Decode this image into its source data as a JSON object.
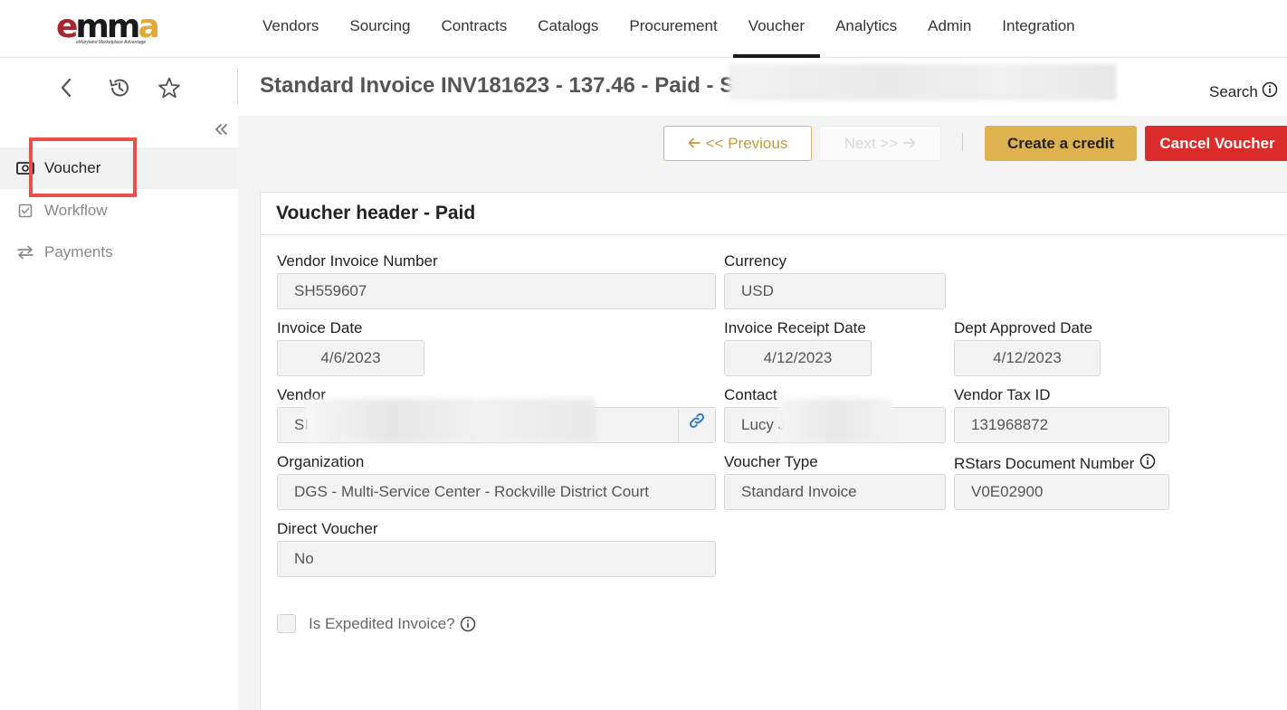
{
  "logo": {
    "text_e": "e",
    "text_mm": "mm",
    "text_a": "a",
    "tagline": "eMaryland Marketplace Advantage"
  },
  "nav": {
    "items": [
      {
        "label": "Vendors"
      },
      {
        "label": "Sourcing"
      },
      {
        "label": "Contracts"
      },
      {
        "label": "Catalogs"
      },
      {
        "label": "Procurement"
      },
      {
        "label": "Voucher"
      },
      {
        "label": "Analytics"
      },
      {
        "label": "Admin"
      },
      {
        "label": "Integration"
      }
    ],
    "active": "Voucher"
  },
  "subheader": {
    "title": "Standard Invoice INV181623 - 137.46 - Paid - SI",
    "search_label": "Search"
  },
  "sidebar": {
    "items": [
      {
        "label": "Voucher",
        "icon": "money-icon"
      },
      {
        "label": "Workflow",
        "icon": "checkbox-icon"
      },
      {
        "label": "Payments",
        "icon": "transfer-arrows-icon"
      }
    ],
    "active": "Voucher"
  },
  "actions": {
    "previous": "<< Previous",
    "next": "Next >>",
    "create_credit": "Create a credit",
    "cancel_voucher": "Cancel Voucher"
  },
  "card": {
    "title": "Voucher header - Paid",
    "fields": {
      "vendor_invoice_number": {
        "label": "Vendor Invoice Number",
        "value": "SH559607"
      },
      "currency": {
        "label": "Currency",
        "value": "USD"
      },
      "invoice_date": {
        "label": "Invoice Date",
        "value": "4/6/2023"
      },
      "invoice_receipt_date": {
        "label": "Invoice Receipt Date",
        "value": "4/12/2023"
      },
      "dept_approved_date": {
        "label": "Dept Approved Date",
        "value": "4/12/2023"
      },
      "vendor": {
        "label": "Vendor",
        "value": "SI"
      },
      "contact": {
        "label": "Contact",
        "value": "Lucy J"
      },
      "vendor_tax_id": {
        "label": "Vendor Tax ID",
        "value": "131968872"
      },
      "organization": {
        "label": "Organization",
        "value": "DGS - Multi-Service Center - Rockville District Court"
      },
      "voucher_type": {
        "label": "Voucher Type",
        "value": "Standard Invoice"
      },
      "rstars_document_number": {
        "label": "RStars Document Number",
        "value": "V0E02900"
      },
      "direct_voucher": {
        "label": "Direct Voucher",
        "value": "No"
      }
    },
    "expedited_label": "Is Expedited Invoice?"
  },
  "colors": {
    "accent_gold": "#ddb24f",
    "danger_red": "#dc2b2b",
    "highlight_red": "#ef4c4c",
    "logo_red": "#a8272e"
  }
}
